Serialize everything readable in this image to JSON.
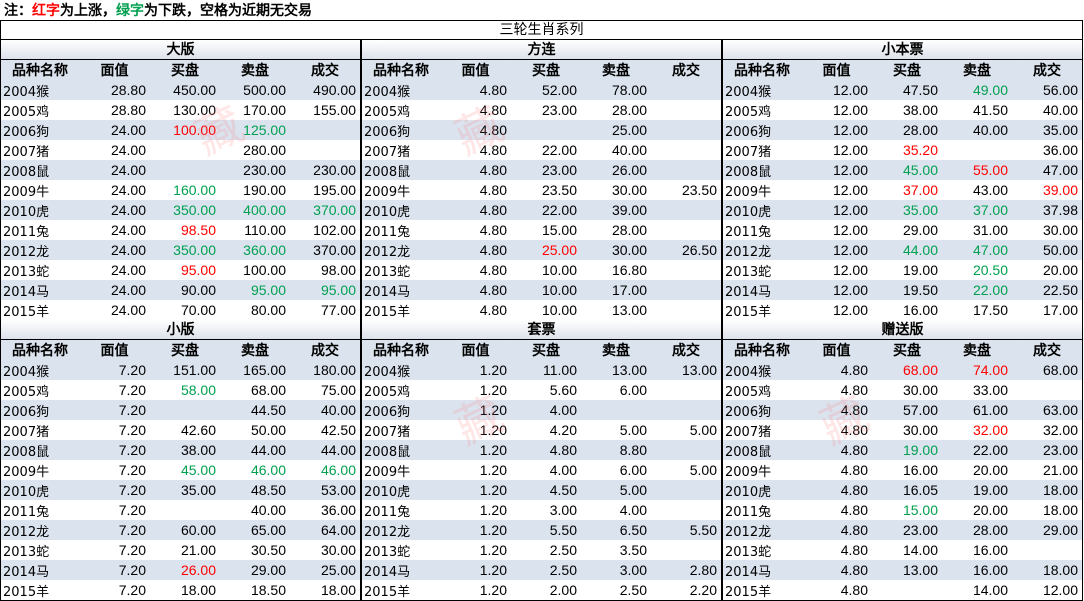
{
  "note": {
    "prefix": "注：",
    "red_word": "红字",
    "mid": "为上涨，",
    "green_word": "绿字",
    "suffix": "为下跌，空格为近期无交易"
  },
  "title": "三轮生肖系列",
  "colors": {
    "up": "#ff0000",
    "down": "#00a050",
    "stripe": "#dbe3ee"
  },
  "headers": [
    "品种名称",
    "面值",
    "买盘",
    "卖盘",
    "成交"
  ],
  "panels": [
    {
      "title": "大版",
      "rows": [
        {
          "name": "2004猴",
          "face": "28.80",
          "bid": "450.00",
          "ask": "500.00",
          "deal": "490.00"
        },
        {
          "name": "2005鸡",
          "face": "28.80",
          "bid": "130.00",
          "ask": "170.00",
          "deal": "155.00"
        },
        {
          "name": "2006狗",
          "face": "24.00",
          "bid": "100.00",
          "bid_c": "up",
          "ask": "125.00",
          "ask_c": "down",
          "deal": ""
        },
        {
          "name": "2007猪",
          "face": "24.00",
          "bid": "",
          "ask": "280.00",
          "deal": ""
        },
        {
          "name": "2008鼠",
          "face": "24.00",
          "bid": "",
          "ask": "230.00",
          "deal": "230.00"
        },
        {
          "name": "2009牛",
          "face": "24.00",
          "bid": "160.00",
          "bid_c": "down",
          "ask": "190.00",
          "deal": "195.00"
        },
        {
          "name": "2010虎",
          "face": "24.00",
          "bid": "350.00",
          "bid_c": "down",
          "ask": "400.00",
          "ask_c": "down",
          "deal": "370.00",
          "deal_c": "down"
        },
        {
          "name": "2011兔",
          "face": "24.00",
          "bid": "98.50",
          "bid_c": "up",
          "ask": "110.00",
          "deal": "102.00"
        },
        {
          "name": "2012龙",
          "face": "24.00",
          "bid": "350.00",
          "bid_c": "down",
          "ask": "360.00",
          "ask_c": "down",
          "deal": "370.00"
        },
        {
          "name": "2013蛇",
          "face": "24.00",
          "bid": "95.00",
          "bid_c": "up",
          "ask": "100.00",
          "deal": "98.00"
        },
        {
          "name": "2014马",
          "face": "24.00",
          "bid": "90.00",
          "ask": "95.00",
          "ask_c": "down",
          "deal": "95.00",
          "deal_c": "down"
        },
        {
          "name": "2015羊",
          "face": "24.00",
          "bid": "70.00",
          "ask": "80.00",
          "deal": "77.00"
        }
      ]
    },
    {
      "title": "方连",
      "rows": [
        {
          "name": "2004猴",
          "face": "4.80",
          "bid": "52.00",
          "ask": "78.00",
          "deal": ""
        },
        {
          "name": "2005鸡",
          "face": "4.80",
          "bid": "23.00",
          "ask": "28.00",
          "deal": ""
        },
        {
          "name": "2006狗",
          "face": "4.80",
          "bid": "",
          "ask": "25.00",
          "deal": ""
        },
        {
          "name": "2007猪",
          "face": "4.80",
          "bid": "22.00",
          "ask": "40.00",
          "deal": ""
        },
        {
          "name": "2008鼠",
          "face": "4.80",
          "bid": "23.00",
          "ask": "26.00",
          "deal": ""
        },
        {
          "name": "2009牛",
          "face": "4.80",
          "bid": "23.50",
          "ask": "30.00",
          "deal": "23.50"
        },
        {
          "name": "2010虎",
          "face": "4.80",
          "bid": "22.00",
          "ask": "39.00",
          "deal": ""
        },
        {
          "name": "2011兔",
          "face": "4.80",
          "bid": "15.00",
          "ask": "28.00",
          "deal": ""
        },
        {
          "name": "2012龙",
          "face": "4.80",
          "bid": "25.00",
          "bid_c": "up",
          "ask": "30.00",
          "deal": "26.50"
        },
        {
          "name": "2013蛇",
          "face": "4.80",
          "bid": "10.00",
          "ask": "16.80",
          "deal": ""
        },
        {
          "name": "2014马",
          "face": "4.80",
          "bid": "10.00",
          "ask": "17.00",
          "deal": ""
        },
        {
          "name": "2015羊",
          "face": "4.80",
          "bid": "10.00",
          "ask": "13.00",
          "deal": ""
        }
      ]
    },
    {
      "title": "小本票",
      "rows": [
        {
          "name": "2004猴",
          "face": "12.00",
          "bid": "47.50",
          "ask": "49.00",
          "ask_c": "down",
          "deal": "56.00"
        },
        {
          "name": "2005鸡",
          "face": "12.00",
          "bid": "38.00",
          "ask": "41.50",
          "deal": "40.00"
        },
        {
          "name": "2006狗",
          "face": "12.00",
          "bid": "28.00",
          "ask": "40.00",
          "deal": "35.00"
        },
        {
          "name": "2007猪",
          "face": "12.00",
          "bid": "35.20",
          "bid_c": "up",
          "ask": "",
          "deal": "36.00"
        },
        {
          "name": "2008鼠",
          "face": "12.00",
          "bid": "45.00",
          "bid_c": "down",
          "ask": "55.00",
          "ask_c": "up",
          "deal": "47.00"
        },
        {
          "name": "2009牛",
          "face": "12.00",
          "bid": "37.00",
          "bid_c": "up",
          "ask": "43.00",
          "deal": "39.00",
          "deal_c": "up"
        },
        {
          "name": "2010虎",
          "face": "12.00",
          "bid": "35.00",
          "bid_c": "down",
          "ask": "37.00",
          "ask_c": "down",
          "deal": "37.98"
        },
        {
          "name": "2011兔",
          "face": "12.00",
          "bid": "29.00",
          "ask": "31.00",
          "deal": "30.00"
        },
        {
          "name": "2012龙",
          "face": "12.00",
          "bid": "44.00",
          "bid_c": "down",
          "ask": "47.00",
          "ask_c": "down",
          "deal": "50.00"
        },
        {
          "name": "2013蛇",
          "face": "12.00",
          "bid": "19.00",
          "ask": "20.50",
          "ask_c": "down",
          "deal": "20.00"
        },
        {
          "name": "2014马",
          "face": "12.00",
          "bid": "19.50",
          "ask": "22.00",
          "ask_c": "down",
          "deal": "22.50"
        },
        {
          "name": "2015羊",
          "face": "12.00",
          "bid": "16.00",
          "ask": "17.50",
          "deal": "17.00"
        }
      ]
    },
    {
      "title": "小版",
      "rows": [
        {
          "name": "2004猴",
          "face": "7.20",
          "bid": "151.00",
          "ask": "165.00",
          "deal": "180.00"
        },
        {
          "name": "2005鸡",
          "face": "7.20",
          "bid": "58.00",
          "bid_c": "down",
          "ask": "68.00",
          "deal": "75.00"
        },
        {
          "name": "2006狗",
          "face": "7.20",
          "bid": "",
          "ask": "44.50",
          "deal": "40.00"
        },
        {
          "name": "2007猪",
          "face": "7.20",
          "bid": "42.60",
          "ask": "50.00",
          "deal": "42.50"
        },
        {
          "name": "2008鼠",
          "face": "7.20",
          "bid": "38.00",
          "ask": "44.00",
          "deal": "44.00"
        },
        {
          "name": "2009牛",
          "face": "7.20",
          "bid": "45.00",
          "bid_c": "down",
          "ask": "46.00",
          "ask_c": "down",
          "deal": "46.00",
          "deal_c": "down"
        },
        {
          "name": "2010虎",
          "face": "7.20",
          "bid": "35.00",
          "ask": "48.50",
          "deal": "53.00"
        },
        {
          "name": "2011兔",
          "face": "7.20",
          "bid": "",
          "ask": "40.00",
          "deal": "36.00"
        },
        {
          "name": "2012龙",
          "face": "7.20",
          "bid": "60.00",
          "ask": "65.00",
          "deal": "64.00"
        },
        {
          "name": "2013蛇",
          "face": "7.20",
          "bid": "21.00",
          "ask": "30.50",
          "deal": "30.00"
        },
        {
          "name": "2014马",
          "face": "7.20",
          "bid": "26.00",
          "bid_c": "up",
          "ask": "29.00",
          "deal": "25.00"
        },
        {
          "name": "2015羊",
          "face": "7.20",
          "bid": "18.00",
          "ask": "18.50",
          "deal": "18.00"
        }
      ]
    },
    {
      "title": "套票",
      "rows": [
        {
          "name": "2004猴",
          "face": "1.20",
          "bid": "11.00",
          "ask": "13.00",
          "deal": "13.00"
        },
        {
          "name": "2005鸡",
          "face": "1.20",
          "bid": "5.60",
          "ask": "6.00",
          "deal": ""
        },
        {
          "name": "2006狗",
          "face": "1.20",
          "bid": "4.00",
          "ask": "",
          "deal": ""
        },
        {
          "name": "2007猪",
          "face": "1.20",
          "bid": "4.20",
          "ask": "5.00",
          "deal": "5.00"
        },
        {
          "name": "2008鼠",
          "face": "1.20",
          "bid": "4.80",
          "ask": "8.80",
          "deal": ""
        },
        {
          "name": "2009牛",
          "face": "1.20",
          "bid": "4.00",
          "ask": "6.00",
          "deal": "5.00"
        },
        {
          "name": "2010虎",
          "face": "1.20",
          "bid": "4.50",
          "ask": "5.00",
          "deal": ""
        },
        {
          "name": "2011兔",
          "face": "1.20",
          "bid": "3.00",
          "ask": "4.00",
          "deal": ""
        },
        {
          "name": "2012龙",
          "face": "1.20",
          "bid": "5.50",
          "ask": "6.50",
          "deal": "5.50"
        },
        {
          "name": "2013蛇",
          "face": "1.20",
          "bid": "2.50",
          "ask": "3.50",
          "deal": ""
        },
        {
          "name": "2014马",
          "face": "1.20",
          "bid": "2.50",
          "ask": "3.00",
          "deal": "2.80"
        },
        {
          "name": "2015羊",
          "face": "1.20",
          "bid": "2.00",
          "ask": "2.50",
          "deal": "2.20"
        }
      ]
    },
    {
      "title": "赠送版",
      "rows": [
        {
          "name": "2004猴",
          "face": "4.80",
          "bid": "68.00",
          "bid_c": "up",
          "ask": "74.00",
          "ask_c": "up",
          "deal": "68.00"
        },
        {
          "name": "2005鸡",
          "face": "4.80",
          "bid": "30.00",
          "ask": "33.00",
          "deal": ""
        },
        {
          "name": "2006狗",
          "face": "4.80",
          "bid": "57.00",
          "ask": "61.00",
          "deal": "63.00"
        },
        {
          "name": "2007猪",
          "face": "4.80",
          "bid": "30.00",
          "ask": "32.00",
          "ask_c": "up",
          "deal": "32.00"
        },
        {
          "name": "2008鼠",
          "face": "4.80",
          "bid": "19.00",
          "bid_c": "down",
          "ask": "22.00",
          "deal": "23.00"
        },
        {
          "name": "2009牛",
          "face": "4.80",
          "bid": "16.00",
          "ask": "20.00",
          "deal": "21.00"
        },
        {
          "name": "2010虎",
          "face": "4.80",
          "bid": "16.05",
          "ask": "19.00",
          "deal": "18.00"
        },
        {
          "name": "2011兔",
          "face": "4.80",
          "bid": "15.00",
          "bid_c": "down",
          "ask": "20.00",
          "deal": "18.00"
        },
        {
          "name": "2012龙",
          "face": "4.80",
          "bid": "23.00",
          "ask": "28.00",
          "deal": "29.00"
        },
        {
          "name": "2013蛇",
          "face": "4.80",
          "bid": "14.00",
          "ask": "16.00",
          "deal": ""
        },
        {
          "name": "2014马",
          "face": "4.80",
          "bid": "13.00",
          "ask": "16.00",
          "deal": "18.00"
        },
        {
          "name": "2015羊",
          "face": "4.80",
          "bid": "",
          "ask": "14.00",
          "deal": "12.00"
        }
      ]
    }
  ]
}
